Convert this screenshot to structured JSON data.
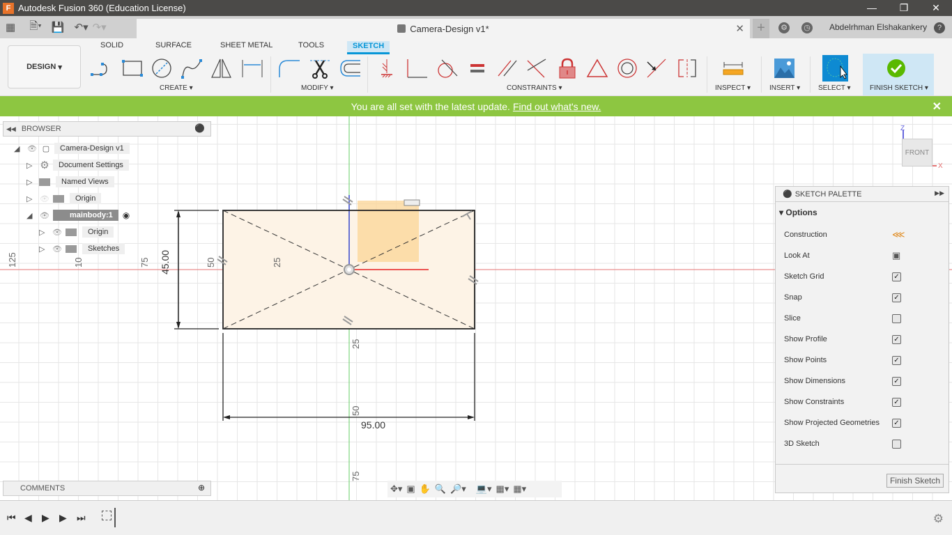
{
  "window": {
    "title": "Autodesk Fusion 360 (Education License)",
    "app_icon": "F",
    "controls": [
      "minimize-icon",
      "restore-icon",
      "close-icon"
    ]
  },
  "tabbar": {
    "document_title": "Camera-Design v1*",
    "user_name": "Abdelrhman Elshakankery",
    "icons": [
      "apps-grid-icon",
      "file-icon",
      "save-icon",
      "undo-icon",
      "redo-icon",
      "new-tab-icon",
      "jobs-icon",
      "clock-icon",
      "help-icon"
    ]
  },
  "ribbon": {
    "workspace": "DESIGN",
    "tabs": [
      {
        "label": "SOLID",
        "active": false
      },
      {
        "label": "SURFACE",
        "active": false
      },
      {
        "label": "SHEET METAL",
        "active": false
      },
      {
        "label": "TOOLS",
        "active": false
      },
      {
        "label": "SKETCH",
        "active": true
      }
    ],
    "groups": {
      "create": "CREATE",
      "modify": "MODIFY",
      "constraints": "CONSTRAINTS",
      "inspect": "INSPECT",
      "insert": "INSERT",
      "select": "SELECT",
      "finish": "FINISH SKETCH"
    },
    "create_tools": [
      "line-icon",
      "rectangle-icon",
      "circle-icon",
      "spline-icon",
      "mirror-icon",
      "sketch-dimension-icon"
    ],
    "modify_tools": [
      "fillet-icon",
      "trim-icon",
      "offset-icon"
    ],
    "constraint_tools": [
      "fix-icon",
      "perpendicular-icon",
      "tangent-icon",
      "equal-icon",
      "parallel-icon",
      "coincident-icon",
      "lock-icon",
      "triangle-icon",
      "concentric-icon",
      "midpoint-icon",
      "symmetry-icon"
    ]
  },
  "banner": {
    "message": "You are all set with the latest update.",
    "link": "Find out what's new."
  },
  "browser": {
    "title": "BROWSER",
    "items": [
      {
        "label": "Camera-Design v1",
        "level": 0,
        "expanded": true
      },
      {
        "label": "Document Settings",
        "level": 1,
        "expanded": false
      },
      {
        "label": "Named Views",
        "level": 1,
        "expanded": false
      },
      {
        "label": "Origin",
        "level": 1,
        "expanded": false,
        "hidden": true
      },
      {
        "label": "mainbody:1",
        "level": 1,
        "expanded": true,
        "active": true
      },
      {
        "label": "Origin",
        "level": 2,
        "expanded": false
      },
      {
        "label": "Sketches",
        "level": 2,
        "expanded": false
      }
    ]
  },
  "comments": {
    "title": "COMMENTS"
  },
  "canvas": {
    "dimensions": {
      "height": "45.00",
      "width": "95.00"
    },
    "grid_labels": {
      "horizontal": [
        "125",
        "10",
        "75",
        "50",
        "25"
      ],
      "vertical": [
        "25",
        "50",
        "75"
      ]
    },
    "viewcube": {
      "face": "FRONT",
      "axis_z": "Z",
      "axis_x": "X"
    }
  },
  "sketch_palette": {
    "title": "SKETCH PALETTE",
    "section": "Options",
    "options": [
      {
        "label": "Construction",
        "type": "icon"
      },
      {
        "label": "Look At",
        "type": "icon"
      },
      {
        "label": "Sketch Grid",
        "type": "checkbox",
        "checked": true
      },
      {
        "label": "Snap",
        "type": "checkbox",
        "checked": true
      },
      {
        "label": "Slice",
        "type": "checkbox",
        "checked": false
      },
      {
        "label": "Show Profile",
        "type": "checkbox",
        "checked": true
      },
      {
        "label": "Show Points",
        "type": "checkbox",
        "checked": true
      },
      {
        "label": "Show Dimensions",
        "type": "checkbox",
        "checked": true
      },
      {
        "label": "Show Constraints",
        "type": "checkbox",
        "checked": true
      },
      {
        "label": "Show Projected Geometries",
        "type": "checkbox",
        "checked": true
      },
      {
        "label": "3D Sketch",
        "type": "checkbox",
        "checked": false
      }
    ],
    "finish_button": "Finish Sketch"
  },
  "colors": {
    "accent": "#0696d7",
    "banner": "#8dc641",
    "constraint_red": "#d03030",
    "profile_fill": "#fdf3e6"
  }
}
